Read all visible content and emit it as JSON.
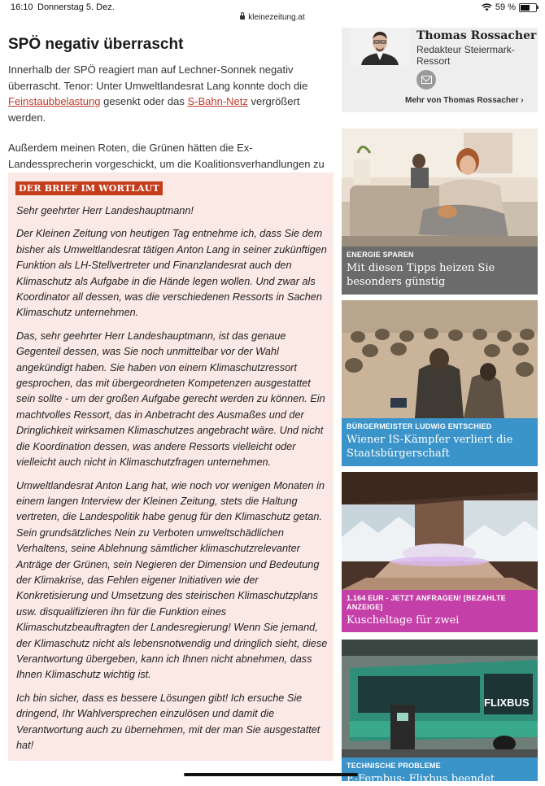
{
  "status_bar": {
    "time": "16:10",
    "date": "Donnerstag 5. Dez.",
    "url": "kleinezeitung.at",
    "battery": "59 %",
    "battery_level": 0.59
  },
  "article": {
    "title": "SPÖ negativ überrascht",
    "para1_a": "Innerhalb der SPÖ reagiert man auf Lechner-Sonnek negativ überrascht. Tenor: Unter Umweltlandesrat Lang konnte doch die ",
    "para1_link1": "Feinstaubbelastung",
    "para1_b": " gesenkt oder das ",
    "para1_link2": "S-Bahn-Netz",
    "para1_c": " vergrößert werden.",
    "para2": "Außerdem meinen Roten, die Grünen hätten die Ex-Landessprecherin vorgeschickt, um die Koalitionsverhandlungen zu stören."
  },
  "letter": {
    "tag": "DER BRIEF IM WORTLAUT",
    "paragraphs": [
      "Sehr geehrter Herr Landeshauptmann!",
      "Der Kleinen Zeitung von heutigen Tag entnehme ich, dass Sie dem bisher als Umweltlandesrat tätigen Anton Lang in seiner zukünftigen Funktion als LH-Stellvertreter und Finanzlandesrat auch den Klimaschutz als Aufgabe in die Hände legen wollen. Und zwar als Koordinator all dessen, was die verschiedenen Ressorts in Sachen Klimaschutz unternehmen.",
      "Das, sehr geehrter Herr Landeshauptmann, ist das genaue Gegenteil dessen, was Sie noch unmittelbar vor der Wahl angekündigt haben. Sie haben von einem Klimaschutzressort gesprochen, das mit übergeordneten Kompetenzen ausgestattet sein sollte - um der großen Aufgabe gerecht werden zu können. Ein machtvolles Ressort, das in Anbetracht des Ausmaßes und der Dringlichkeit wirksamen Klimaschutzes angebracht wäre. Und nicht die Koordination dessen, was andere Ressorts vielleicht oder vielleicht auch nicht in Klimaschutzfragen unternehmen.",
      "Umweltlandesrat Anton Lang hat, wie noch vor wenigen Monaten in einem langen Interview der Kleinen Zeitung, stets die Haltung vertreten, die Landespolitik habe genug für den Klimaschutz getan. Sein grundsätzliches Nein zu Verboten umweltschädlichen Verhaltens, seine Ablehnung sämtlicher klimaschutzrelevanter Anträge der Grünen, sein Negieren der Dimension und Bedeutung der Klimakrise, das Fehlen eigener Initiativen wie der Konkretisierung und Umsetzung des steirischen Klimaschutzplans usw. disqualifizieren ihn für die Funktion eines Klimaschutzbeauftragten der Landesregierung! Wenn Sie jemand, der Klimaschutz nicht als lebensnotwendig und dringlich sieht, diese Verantwortung übergeben, kann ich Ihnen nicht abnehmen, dass Ihnen Klimaschutz wichtig ist.",
      "Ich bin sicher, dass es bessere Lösungen gibt! Ich ersuche Sie dringend, Ihr Wahlversprechen einzulösen und damit die Verantwortung auch zu übernehmen, mit der man Sie ausgestattet hat!"
    ]
  },
  "author": {
    "name": "Thomas Rossacher",
    "role": "Redakteur Steiermark-Ressort",
    "more_link": "Mehr von Thomas Rossacher ›"
  },
  "teasers": [
    {
      "kicker": "ENERGIE SPAREN",
      "title": "Mit diesen Tipps heizen Sie besonders günstig",
      "color": "#6b6b6b"
    },
    {
      "kicker": "BÜRGERMEISTER LUDWIG ENTSCHIED",
      "title": "Wiener IS-Kämpfer verliert die Staatsbürgerschaft",
      "color": "#3a93c9"
    },
    {
      "kicker": "1.164 EUR - JETZT ANFRAGEN! [BEZAHLTE ANZEIGE]",
      "title": "Kuscheltage für zwei",
      "color": "#c53fa8"
    },
    {
      "kicker": "TECHNISCHE PROBLEME",
      "title": "E-Fernbus: Flixbus beendet",
      "color": "#3a93c9"
    }
  ]
}
